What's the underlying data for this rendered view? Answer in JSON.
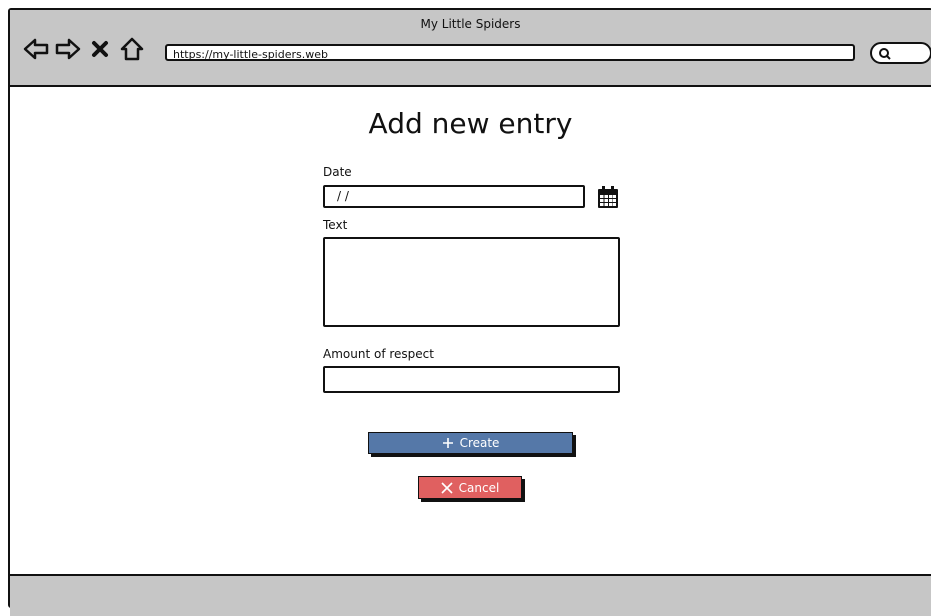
{
  "window": {
    "title": "My Little Spiders"
  },
  "nav": {
    "back_icon": "back-arrow-icon",
    "forward_icon": "forward-arrow-icon",
    "stop_icon": "close-icon",
    "home_icon": "home-icon",
    "url": "https://my-little-spiders.web",
    "search_icon": "search-icon"
  },
  "form": {
    "title": "Add new entry",
    "date_label": "Date",
    "date_value": "/ /",
    "calendar_icon": "calendar-icon",
    "text_label": "Text",
    "text_value": "",
    "respect_label": "Amount of respect",
    "respect_value": "",
    "create_label": "Create",
    "create_icon": "plus-icon",
    "cancel_label": "Cancel",
    "cancel_icon": "close-icon"
  },
  "colors": {
    "chrome": "#c6c6c6",
    "create_button": "#5578a8",
    "cancel_button": "#e06060"
  }
}
